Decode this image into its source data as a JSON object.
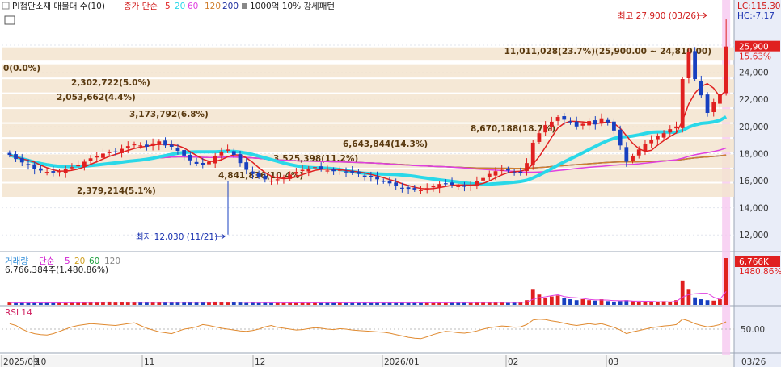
{
  "legend": {
    "series_name": "PI첨단소재 매물대 수(10)",
    "price_label": "종가 단순",
    "ma_periods": [
      "5",
      "20",
      "60",
      "120",
      "200"
    ],
    "ma_colors": [
      "#e02020",
      "#2ad8e8",
      "#e040e0",
      "#d08030",
      "#2030a0"
    ],
    "pattern_label": "1000억 10% 강세패턴"
  },
  "indicator_readouts": {
    "lc": "LC:115.30",
    "hc": "HC:-7.17"
  },
  "price_panel": {
    "y_ticks": [
      "26,000",
      "24,000",
      "22,000",
      "20,000",
      "18,000",
      "16,000",
      "14,000",
      "12,000"
    ],
    "current_price_tag": "25,900",
    "current_change_tag": "15.63%",
    "high_annotation": "최고 27,900 (03/26)",
    "low_annotation": "최저 12,030 (11/21)"
  },
  "volume_profile": [
    {
      "label": "11,011,028(23.7%)(25,900.00 ~ 24,810.00)",
      "price": 25350
    },
    {
      "label": "0(0.0%)",
      "price": 24100
    },
    {
      "label": "2,302,722(5.0%)",
      "price": 23000
    },
    {
      "label": "2,053,662(4.4%)",
      "price": 21900
    },
    {
      "label": "3,173,792(6.8%)",
      "price": 20800
    },
    {
      "label": "8,670,188(18.7%)",
      "price": 19700
    },
    {
      "label": "6,643,844(14.3%)",
      "price": 18600
    },
    {
      "label": "3,525,398(11.2%)",
      "price": 17450
    },
    {
      "label": "4,841,836(10.4%)",
      "price": 16400
    },
    {
      "label": "2,379,214(5.1%)",
      "price": 15300
    }
  ],
  "volume_panel": {
    "title": "거래량",
    "ma_label": "단순",
    "ma_periods": [
      "5",
      "20",
      "60",
      "120"
    ],
    "readout": "6,766,384주(1,480.86%)",
    "current_tag": "6,766K",
    "change_tag": "1480.86%"
  },
  "rsi_panel": {
    "title": "RSI 14",
    "y_tick": "50.00"
  },
  "x_axis": {
    "labels": [
      "2025/09",
      "10",
      "11",
      "12",
      "2026/01",
      "02",
      "03",
      "03/26"
    ]
  },
  "chart_data": {
    "type": "candlestick",
    "ylim": [
      11000,
      28500
    ],
    "closes": [
      17900,
      17600,
      17350,
      17150,
      16850,
      16750,
      16650,
      16600,
      16700,
      16850,
      17000,
      17150,
      17400,
      17650,
      17800,
      18000,
      18100,
      18150,
      18350,
      18550,
      18700,
      18600,
      18500,
      18750,
      18900,
      18600,
      18500,
      18200,
      17850,
      17500,
      17250,
      17150,
      17400,
      17800,
      18150,
      18300,
      17900,
      17300,
      16800,
      16500,
      16300,
      16100,
      16000,
      16100,
      16250,
      16450,
      16650,
      16800,
      16900,
      17000,
      16850,
      16750,
      16700,
      16800,
      16650,
      16600,
      16500,
      16300,
      16250,
      16100,
      15950,
      15800,
      15600,
      15450,
      15400,
      15350,
      15300,
      15450,
      15600,
      15750,
      15800,
      15700,
      15600,
      15550,
      15700,
      15950,
      16200,
      16500,
      16700,
      16800,
      16750,
      16600,
      16650,
      17300,
      18800,
      19500,
      20100,
      20350,
      20700,
      20500,
      20300,
      20000,
      20200,
      20400,
      20150,
      20600,
      20300,
      19700,
      18600,
      17400,
      17800,
      18300,
      18700,
      19000,
      19300,
      19500,
      19800,
      20000,
      23500,
      25500,
      23500,
      22300,
      21000,
      21800,
      22400,
      25900
    ],
    "volume_rel": [
      0.05,
      0.04,
      0.05,
      0.04,
      0.05,
      0.04,
      0.05,
      0.04,
      0.05,
      0.04,
      0.05,
      0.06,
      0.05,
      0.06,
      0.05,
      0.06,
      0.07,
      0.05,
      0.06,
      0.05,
      0.05,
      0.06,
      0.05,
      0.06,
      0.05,
      0.06,
      0.05,
      0.06,
      0.05,
      0.06,
      0.05,
      0.06,
      0.05,
      0.07,
      0.06,
      0.05,
      0.06,
      0.05,
      0.04,
      0.05,
      0.04,
      0.05,
      0.04,
      0.05,
      0.04,
      0.05,
      0.04,
      0.05,
      0.04,
      0.05,
      0.04,
      0.05,
      0.04,
      0.05,
      0.04,
      0.05,
      0.04,
      0.05,
      0.04,
      0.05,
      0.04,
      0.05,
      0.04,
      0.05,
      0.04,
      0.05,
      0.04,
      0.05,
      0.04,
      0.05,
      0.04,
      0.05,
      0.06,
      0.05,
      0.04,
      0.05,
      0.06,
      0.05,
      0.06,
      0.05,
      0.04,
      0.05,
      0.06,
      0.1,
      0.34,
      0.22,
      0.14,
      0.18,
      0.2,
      0.15,
      0.12,
      0.1,
      0.12,
      0.1,
      0.09,
      0.12,
      0.08,
      0.07,
      0.08,
      0.1,
      0.08,
      0.07,
      0.06,
      0.07,
      0.06,
      0.08,
      0.06,
      0.1,
      0.52,
      0.34,
      0.16,
      0.12,
      0.1,
      0.09,
      0.12,
      1.0
    ],
    "rsi": [
      62,
      58,
      50,
      44,
      40,
      38,
      37,
      40,
      45,
      50,
      55,
      58,
      60,
      62,
      61,
      60,
      59,
      58,
      60,
      62,
      64,
      58,
      52,
      48,
      44,
      42,
      40,
      45,
      50,
      52,
      55,
      60,
      58,
      55,
      52,
      50,
      48,
      46,
      45,
      47,
      50,
      55,
      58,
      54,
      52,
      50,
      48,
      49,
      51,
      53,
      52,
      50,
      49,
      51,
      50,
      48,
      47,
      46,
      45,
      44,
      43,
      41,
      38,
      35,
      32,
      30,
      29,
      33,
      38,
      42,
      45,
      44,
      42,
      41,
      43,
      46,
      50,
      53,
      55,
      57,
      56,
      54,
      55,
      60,
      70,
      72,
      71,
      68,
      66,
      63,
      60,
      58,
      60,
      62,
      60,
      62,
      58,
      54,
      48,
      40,
      44,
      47,
      50,
      53,
      55,
      57,
      58,
      60,
      72,
      68,
      62,
      58,
      55,
      57,
      60,
      66
    ],
    "ma_series": [
      "5",
      "20",
      "60",
      "120",
      "200"
    ]
  }
}
